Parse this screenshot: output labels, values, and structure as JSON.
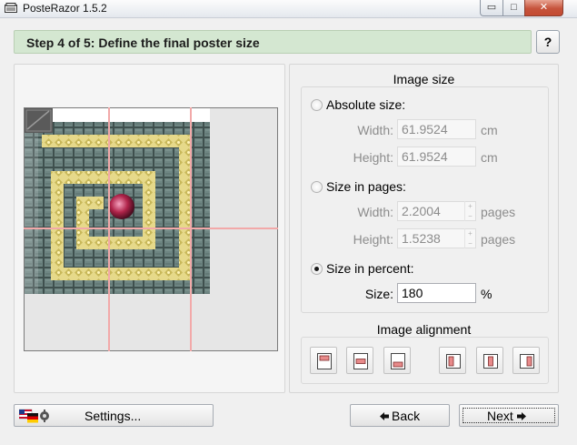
{
  "window": {
    "title": "PosteRazor 1.5.2",
    "background_tabs": [
      "",
      "",
      "",
      "",
      ""
    ],
    "controls": {
      "minimize": "▭",
      "maximize": "□",
      "close": "✕"
    }
  },
  "header": {
    "step_title": "Step 4 of 5: Define the final poster size",
    "help_label": "?"
  },
  "image_size": {
    "title": "Image size",
    "absolute": {
      "label": "Absolute size:",
      "selected": false,
      "width_label": "Width:",
      "width_value": "61.9524",
      "width_unit": "cm",
      "height_label": "Height:",
      "height_value": "61.9524",
      "height_unit": "cm"
    },
    "pages": {
      "label": "Size in pages:",
      "selected": false,
      "width_label": "Width:",
      "width_value": "2.2004",
      "width_unit": "pages",
      "height_label": "Height:",
      "height_value": "1.5238",
      "height_unit": "pages"
    },
    "percent": {
      "label": "Size in percent:",
      "selected": true,
      "size_label": "Size:",
      "size_value": "180",
      "size_unit": "%"
    }
  },
  "image_alignment": {
    "title": "Image alignment",
    "buttons": [
      "align-top",
      "align-center",
      "align-bottom",
      "align-left",
      "align-middle",
      "align-right"
    ]
  },
  "footer": {
    "settings_label": "Settings...",
    "back_label": "Back",
    "next_label": "Next"
  },
  "colors": {
    "header_bg": "#d4e7d1",
    "page_grid_line": "#f2a9a9",
    "maze_floor": "#6e8582",
    "maze_path": "#e6d98a",
    "orb": "#b0244a",
    "close_button": "#c6533b"
  }
}
